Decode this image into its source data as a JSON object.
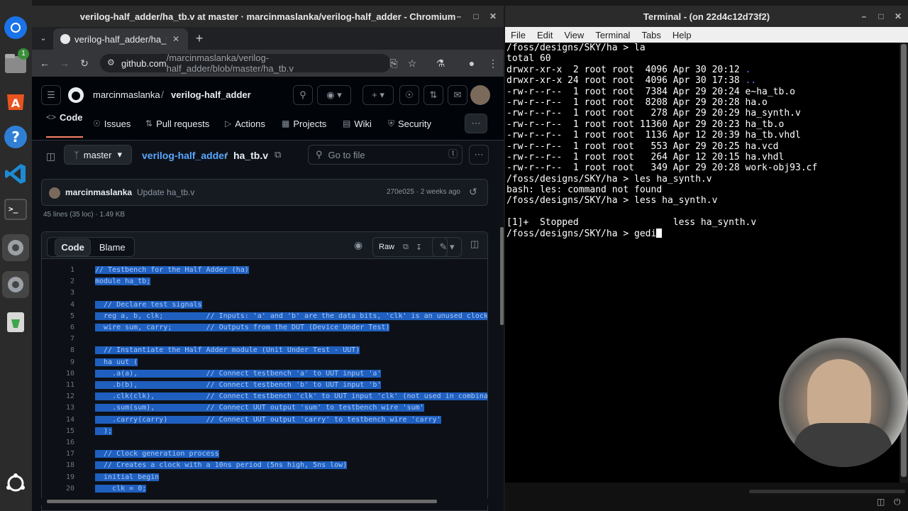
{
  "dock": {
    "items": [
      "chromium-icon",
      "files-icon",
      "app-store-icon",
      "help-icon",
      "vscode-icon",
      "terminal-icon",
      "settings-icon",
      "settings-icon-2",
      "trash-icon",
      "ubuntu-icon"
    ],
    "files_badge": "1"
  },
  "browser": {
    "window_title": "verilog-half_adder/ha_tb.v at master · marcinmaslanka/verilog-half_adder - Chromium",
    "tab_title": "verilog-half_adder/ha_tb",
    "url_host": "github.com",
    "url_path": "/marcinmaslanka/verilog-half_adder/blob/master/ha_tb.v",
    "owner": "marcinmaslanka",
    "separator": "/",
    "repo": "verilog-half_adder",
    "nav": [
      "Code",
      "Issues",
      "Pull requests",
      "Actions",
      "Projects",
      "Wiki",
      "Security"
    ],
    "branch": "master",
    "breadcrumb_repo": "verilog-half_adder",
    "breadcrumb_sep": "/",
    "breadcrumb_file": "ha_tb.v",
    "goto_placeholder": "Go to file",
    "goto_key": "t",
    "commit_author": "marcinmaslanka",
    "commit_message": "Update ha_tb.v",
    "commit_meta": "270e025 · 2 weeks ago",
    "file_stats": "45 lines (35 loc) · 1.49 KB",
    "view_tabs": [
      "Code",
      "Blame"
    ],
    "raw_label": "Raw",
    "code_lines": [
      "// Testbench for the Half Adder (ha)",
      "module ha_tb;",
      "",
      "  // Declare test signals",
      "  reg a, b, clk;          // Inputs: 'a' and 'b' are the data bits, 'clk' is an unused clock h",
      "  wire sum, carry;        // Outputs from the DUT (Device Under Test)",
      "",
      "  // Instantiate the Half Adder module (Unit Under Test - UUT)",
      "  ha uut (",
      "    .a(a),                // Connect testbench 'a' to UUT input 'a'",
      "    .b(b),                // Connect testbench 'b' to UUT input 'b'",
      "    .clk(clk),            // Connect testbench 'clk' to UUT input 'clk' (not used in combinati",
      "    .sum(sum),            // Connect UUT output 'sum' to testbench wire 'sum'",
      "    .carry(carry)         // Connect UUT output 'carry' to testbench wire 'carry'",
      "  );",
      "",
      "  // Clock generation process",
      "  // Creates a clock with a 10ns period (5ns high, 5ns low)",
      "  initial begin",
      "    clk = 0;"
    ]
  },
  "terminal": {
    "window_title": "Terminal - (on 22d4c12d73f2)",
    "menu": [
      "File",
      "Edit",
      "View",
      "Terminal",
      "Tabs",
      "Help"
    ],
    "prompt": "/foss/designs/SKY/ha > ",
    "lines": [
      {
        "type": "cmd",
        "text": "la"
      },
      {
        "type": "out",
        "text": "total 60"
      },
      {
        "type": "out",
        "text": "drwxr-xr-x  2 root root  4096 Apr 30 20:12 ",
        "blue": "."
      },
      {
        "type": "out",
        "text": "drwxr-xr-x 24 root root  4096 Apr 30 17:38 ",
        "blue": ".."
      },
      {
        "type": "out",
        "text": "-rw-r--r--  1 root root  7384 Apr 29 20:24 e~ha_tb.o"
      },
      {
        "type": "out",
        "text": "-rw-r--r--  1 root root  8208 Apr 29 20:28 ha.o"
      },
      {
        "type": "out",
        "text": "-rw-r--r--  1 root root   278 Apr 29 20:29 ha_synth.v"
      },
      {
        "type": "out",
        "text": "-rw-r--r--  1 root root 11360 Apr 29 20:23 ha_tb.o"
      },
      {
        "type": "out",
        "text": "-rw-r--r--  1 root root  1136 Apr 12 20:39 ha_tb.vhdl"
      },
      {
        "type": "out",
        "text": "-rw-r--r--  1 root root   553 Apr 29 20:25 ha.vcd"
      },
      {
        "type": "out",
        "text": "-rw-r--r--  1 root root   264 Apr 12 20:15 ha.vhdl"
      },
      {
        "type": "out",
        "text": "-rw-r--r--  1 root root   349 Apr 29 20:28 work-obj93.cf"
      },
      {
        "type": "cmd",
        "text": "les ha_synth.v"
      },
      {
        "type": "out",
        "text": "bash: les: command not found"
      },
      {
        "type": "cmd",
        "text": "less ha_synth.v"
      },
      {
        "type": "out",
        "text": ""
      },
      {
        "type": "out",
        "text": "[1]+  Stopped                 less ha_synth.v"
      },
      {
        "type": "cmd_active",
        "text": "gedi"
      }
    ]
  }
}
